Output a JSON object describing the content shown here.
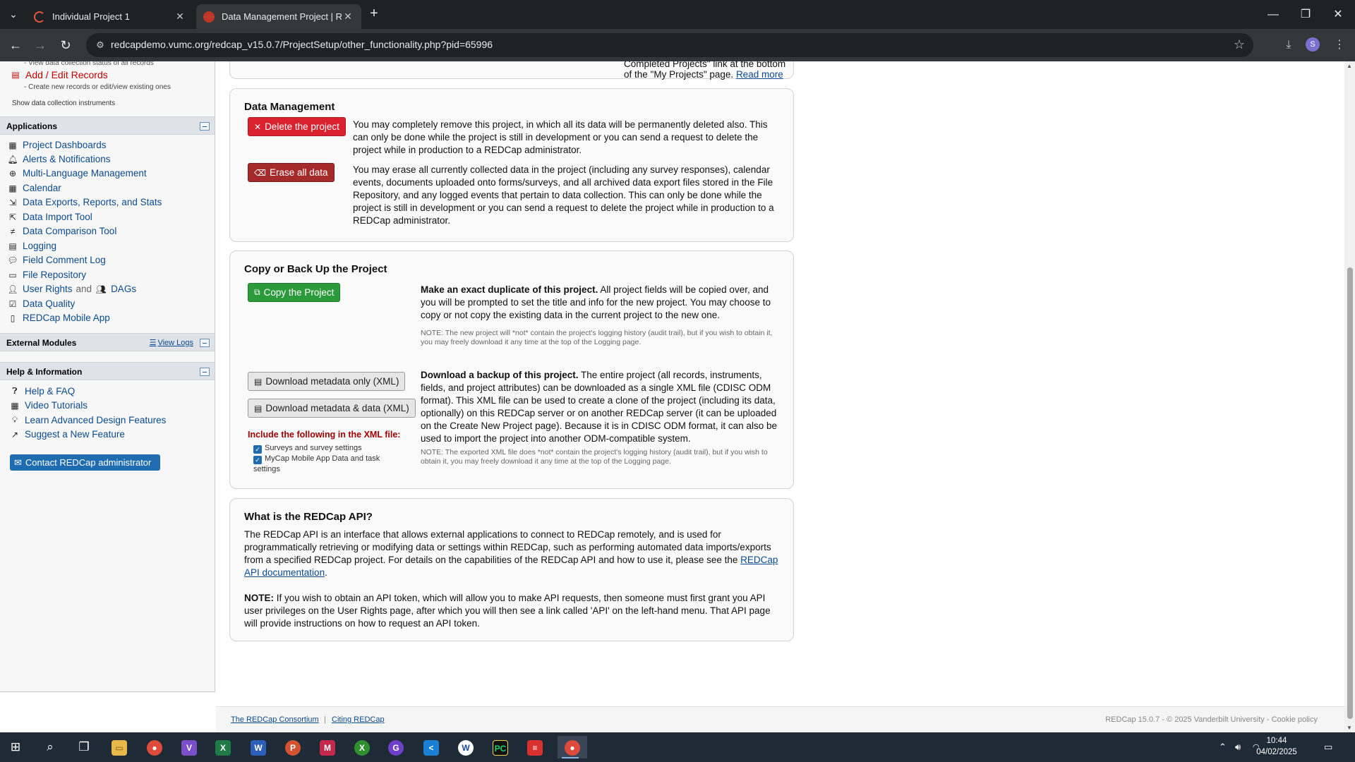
{
  "browser": {
    "tabs": [
      {
        "title": "Individual Project 1",
        "active": false
      },
      {
        "title": "Data Management Project | REDCap",
        "active": true
      }
    ],
    "url": "redcapdemo.vumc.org/redcap_v15.0.7/ProjectSetup/other_functionality.php?pid=65996",
    "profile_initial": "S"
  },
  "sidebar": {
    "cut_text": "- View data collection status of all records",
    "add_edit": {
      "label": "Add / Edit Records",
      "sub": "- Create new records or edit/view existing ones"
    },
    "show_instruments": "Show data collection instruments",
    "applications": {
      "header": "Applications",
      "items": [
        {
          "label": "Project Dashboards",
          "icon": "dashboard-icon"
        },
        {
          "label": "Alerts & Notifications",
          "icon": "bell-icon"
        },
        {
          "label": "Multi-Language Management",
          "icon": "globe-icon"
        },
        {
          "label": "Calendar",
          "icon": "calendar-icon"
        },
        {
          "label": "Data Exports, Reports, and Stats",
          "icon": "export-icon"
        },
        {
          "label": "Data Import Tool",
          "icon": "import-icon"
        },
        {
          "label": "Data Comparison Tool",
          "icon": "compare-icon"
        },
        {
          "label": "Logging",
          "icon": "log-icon"
        },
        {
          "label": "Field Comment Log",
          "icon": "comments-icon"
        },
        {
          "label": "File Repository",
          "icon": "folder-icon"
        },
        {
          "label": "User Rights",
          "icon": "user-icon"
        },
        {
          "label": "Data Quality",
          "icon": "check-icon"
        },
        {
          "label": "REDCap Mobile App",
          "icon": "tablet-icon"
        }
      ],
      "and_text": "and",
      "dags_label": "DAGs"
    },
    "external_modules": {
      "header": "External Modules",
      "view_logs": "View Logs"
    },
    "help": {
      "header": "Help & Information",
      "items": [
        {
          "label": "Help & FAQ",
          "icon": "question-icon"
        },
        {
          "label": "Video Tutorials",
          "icon": "video-icon"
        },
        {
          "label": "Learn Advanced Design Features",
          "icon": "lightbulb-icon"
        },
        {
          "label": "Suggest a New Feature",
          "icon": "external-link-icon"
        }
      ],
      "contact_button": "Contact REDCap administrator"
    }
  },
  "main": {
    "top_cut": {
      "before": "Completed Projects\" link at the bottom of the \"My Projects\" page.",
      "link": "Read more"
    },
    "data_management": {
      "title": "Data Management",
      "delete_button": "Delete the project",
      "delete_text": "You may completely remove this project, in which all its data will be permanently deleted also. This can only be done while the project is still in development or you can send a request to delete the project while in production to a REDCap administrator.",
      "erase_button": "Erase all data",
      "erase_text": "You may erase all currently collected data in the project (including any survey responses), calendar events, documents uploaded onto forms/surveys, and all archived data export files stored in the File Repository, and any logged events that pertain to data collection. This can only be done while the project is still in development or you can send a request to delete the project while in production to a REDCap administrator."
    },
    "copy_backup": {
      "title": "Copy or Back Up the Project",
      "copy_button": "Copy the Project",
      "copy_bold": "Make an exact duplicate of this project.",
      "copy_text": "All project fields will be copied over, and you will be prompted to set the title and info for the new project. You may choose to copy or not copy the existing data in the current project to the new one.",
      "copy_note": "NOTE: The new project will *not* contain the project's logging history (audit trail), but if you wish to obtain it, you may freely download it any time at the top of the Logging page.",
      "download_meta_button": "Download metadata only (XML)",
      "download_data_button": "Download metadata & data (XML)",
      "include_label": "Include the following in the XML file:",
      "checkboxes": [
        {
          "label": "Surveys and survey settings",
          "checked": true
        },
        {
          "label": "MyCap Mobile App Data and task settings",
          "checked": true
        }
      ],
      "backup_bold": "Download a backup of this project.",
      "backup_text": "The entire project (all records, instruments, fields, and project attributes) can be downloaded as a single XML file (CDISC ODM format). This XML file can be used to create a clone of the project (including its data, optionally) on this REDCap server or on another REDCap server (it can be uploaded on the Create New Project page). Because it is in CDISC ODM format, it can also be used to import the project into another ODM-compatible system.",
      "backup_note": "NOTE: The exported XML file does *not* contain the project's logging history (audit trail), but if you wish to obtain it, you may freely download it any time at the top of the Logging page."
    },
    "api": {
      "title": "What is the REDCap API?",
      "p1_before": "The REDCap API is an interface that allows external applications to connect to REDCap remotely, and is used for programmatically retrieving or modifying data or settings within REDCap, such as performing automated data imports/exports from a specified REDCap project. For details on the capabilities of the REDCap API and how to use it, please see the",
      "p1_link": "REDCap API documentation",
      "p1_after": ".",
      "note_bold": "NOTE:",
      "note_text": "If you wish to obtain an API token, which will allow you to make API requests, then someone must first grant you API user privileges on the User Rights page, after which you will then see a link called 'API' on the left-hand menu. That API page will provide instructions on how to request an API token."
    }
  },
  "footer": {
    "consortium": "The REDCap Consortium",
    "citing": "Citing REDCap",
    "version": "REDCap 15.0.7 -  © 2025 Vanderbilt University  -",
    "cookie": "Cookie policy"
  },
  "taskbar": {
    "time": "10:44",
    "date": "04/02/2025"
  }
}
